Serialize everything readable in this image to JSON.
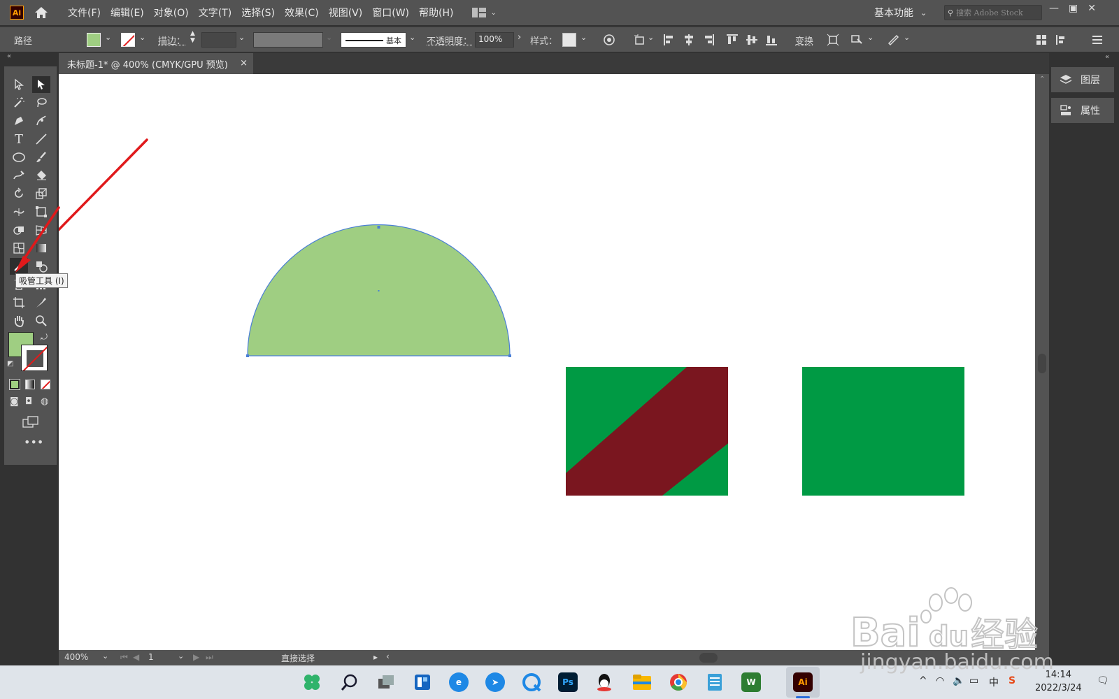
{
  "app": {
    "logo_text": "Ai",
    "menu": [
      "文件(F)",
      "编辑(E)",
      "对象(O)",
      "文字(T)",
      "选择(S)",
      "效果(C)",
      "视图(V)",
      "窗口(W)",
      "帮助(H)"
    ],
    "workspace_label": "基本功能",
    "stock_search_placeholder": "搜索 Adobe Stock"
  },
  "control_bar": {
    "object_type": "路径",
    "stroke_label": "描边：",
    "stroke_profile": "基本",
    "opacity_label": "不透明度：",
    "opacity_value": "100%",
    "style_label": "样式：",
    "transform_label": "变换",
    "fill_color": "#9fce82"
  },
  "document": {
    "tab_title": "未标题-1* @ 400% (CMYK/GPU 预览)",
    "close_glyph": "×"
  },
  "toolbar": {
    "tooltip": "吸管工具 (I)",
    "fill_color": "#9fce82"
  },
  "canvas": {
    "shapes": {
      "half_circle_fill": "#9fce82",
      "selection_color": "#4a7fd6",
      "rect_green": "#009a44",
      "stripe_red": "#7a161f"
    }
  },
  "right_panel": {
    "layers_label": "图层",
    "properties_label": "属性"
  },
  "status_bar": {
    "zoom": "400%",
    "page": "1",
    "current_tool": "直接选择"
  },
  "taskbar": {
    "time": "14:14",
    "date": "2022/3/24",
    "ime": "中"
  },
  "watermark": {
    "brand": "Bai",
    "brand2": "du",
    "brand_cn": "经验",
    "url": "jingyan.baidu.com"
  }
}
